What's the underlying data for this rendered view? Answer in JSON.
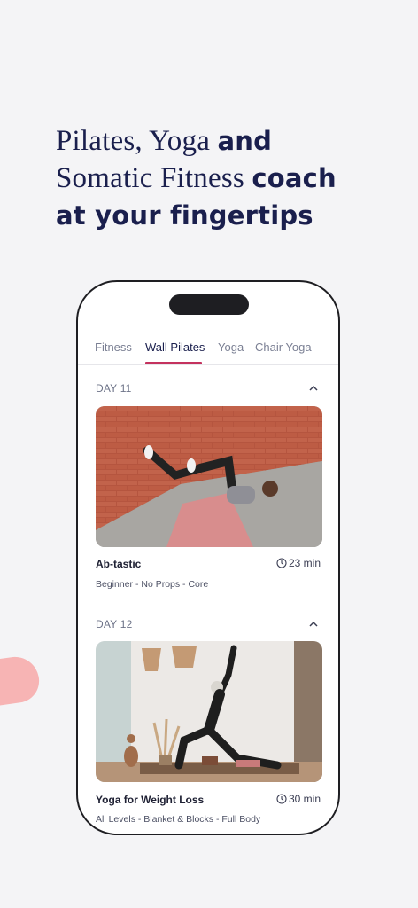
{
  "headline": {
    "line1_regular": "Pilates, Yoga ",
    "line1_bold": "and",
    "line2_regular": "Somatic Fitness ",
    "line2_bold": "coach",
    "line3_bold": "at your fingertips"
  },
  "tabs": [
    {
      "label": "Fitness",
      "active": false
    },
    {
      "label": "Wall Pilates",
      "active": true
    },
    {
      "label": "Yoga",
      "active": false
    },
    {
      "label": "Chair Yoga",
      "active": false
    }
  ],
  "sections": [
    {
      "day": "DAY 11",
      "workout": {
        "title": "Ab-tastic",
        "duration": "23 min",
        "tags": "Beginner - No Props - Core"
      }
    },
    {
      "day": "DAY 12",
      "workout": {
        "title": "Yoga for Weight Loss",
        "duration": "30 min",
        "tags": "All Levels - Blanket & Blocks - Full Body"
      }
    }
  ],
  "colors": {
    "accent": "#c4325e",
    "navy": "#1a1f4d",
    "blob": "#f7b4b4"
  }
}
